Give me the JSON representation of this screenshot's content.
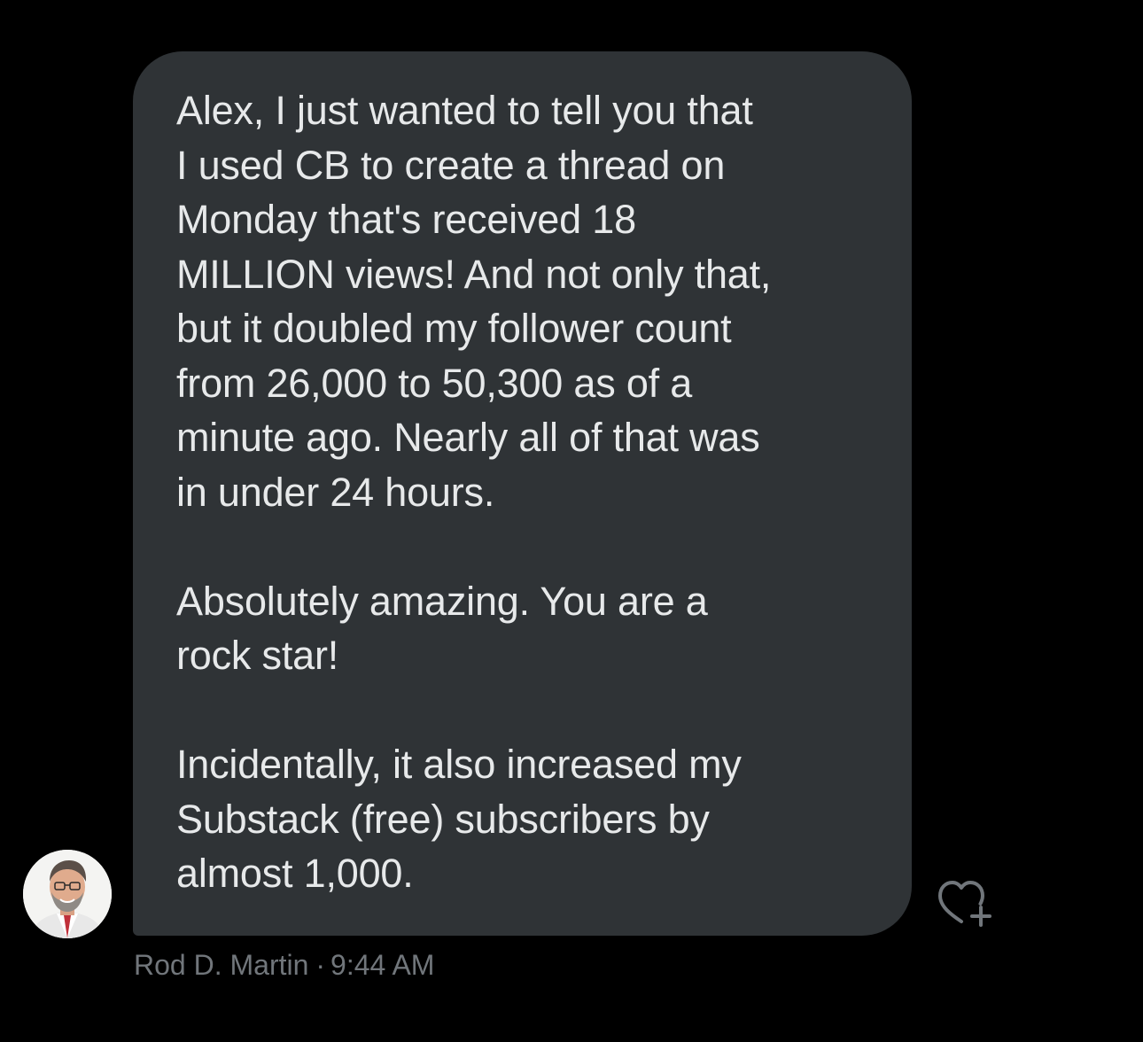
{
  "message": {
    "paragraphs": [
      "Alex, I just wanted to tell you that\nI used CB to create a thread on\nMonday that's received 18\nMILLION views! And not only that,\nbut it doubled my follower count\nfrom 26,000 to 50,300 as of a\nminute ago. Nearly all of that was\nin under 24 hours.",
      "Absolutely amazing. You are a\nrock star!",
      "Incidentally, it also increased my\nSubstack (free) subscribers by\nalmost 1,000."
    ],
    "sender": "Rod D. Martin",
    "separator": "·",
    "time": "9:44 AM"
  },
  "icons": {
    "reaction": "heart-plus-icon",
    "avatar": "avatar-photo"
  },
  "colors": {
    "background": "#000000",
    "bubble": "#2f3336",
    "text": "#e7e9ea",
    "meta": "#71767b"
  }
}
